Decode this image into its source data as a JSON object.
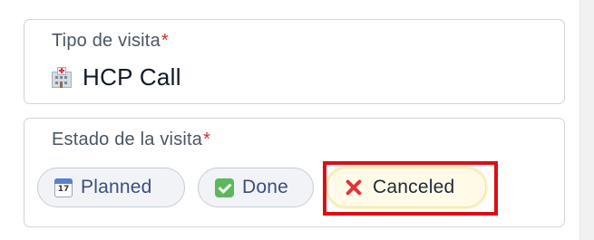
{
  "visit_type": {
    "label": "Tipo de visita",
    "required_marker": "*",
    "value": "HCP Call",
    "value_icon": "hospital-icon"
  },
  "visit_state": {
    "label": "Estado de la visita",
    "required_marker": "*",
    "options": [
      {
        "label": "Planned",
        "icon": "calendar-icon",
        "selected": false
      },
      {
        "label": "Done",
        "icon": "check-mark-icon",
        "selected": false
      },
      {
        "label": "Canceled",
        "icon": "cross-mark-icon",
        "selected": true
      }
    ]
  },
  "colors": {
    "required": "#d22b2b",
    "chip_text": "#3d4f7a",
    "selected_chip_bg": "#fffbe8",
    "highlight_box": "#dd0d17"
  }
}
